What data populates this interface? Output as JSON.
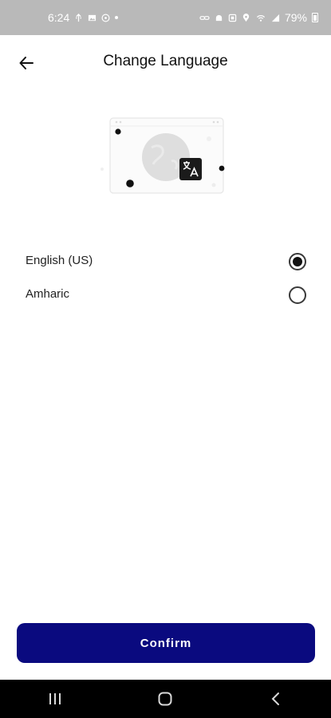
{
  "status_bar": {
    "time": "6:24",
    "battery": "79%",
    "left_icons": [
      "usb-icon",
      "image-icon",
      "clock-icon",
      "dot-icon"
    ],
    "right_icons": [
      "link-icon",
      "alarm-icon",
      "nfc-icon",
      "location-icon",
      "wifi-icon",
      "signal-icon",
      "battery-icon"
    ]
  },
  "header": {
    "title": "Change Language",
    "back_icon": "arrow-left-icon"
  },
  "illustration": {
    "icon": "translate-icon"
  },
  "languages": [
    {
      "label": "English (US)",
      "selected": true
    },
    {
      "label": "Amharic",
      "selected": false
    }
  ],
  "confirm": {
    "label": "Confirm"
  },
  "colors": {
    "accent": "#0a0a7f",
    "status_bar": "#b9b9b9",
    "nav_bar": "#000000"
  },
  "nav_bar": {
    "icons": [
      "recent-apps-icon",
      "home-icon",
      "back-icon"
    ]
  }
}
